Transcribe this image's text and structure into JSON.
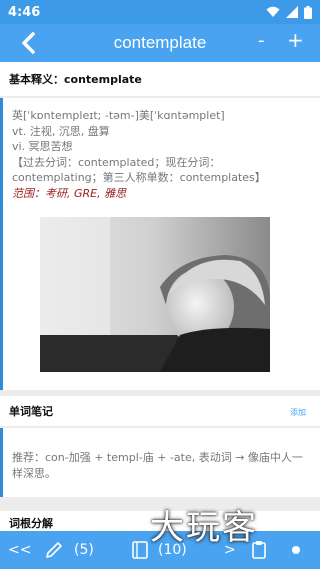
{
  "status": {
    "time": "4:46"
  },
  "appbar": {
    "title": "contemplate",
    "minus": "-",
    "plus": "+"
  },
  "basic": {
    "header": "基本释义：contemplate",
    "phonetic": "英[ˈkɒntempleɪt; -təm-]美[ˈkɑntəmplet]",
    "def1": "vt. 注视, 沉思, 盘算",
    "def2": "vi. 冥思苦想",
    "forms": "【过去分词：contemplated；现在分词：contemplating；第三人称单数：contemplates】",
    "scope": "范围：考研, GRE, 雅思"
  },
  "notes": {
    "header": "单词笔记",
    "link": "添加",
    "text": "推荐：con-加强 + templ-庙 + -ate, 表动词 → 像庙中人一样深思。"
  },
  "roots": {
    "header": "词根分解"
  },
  "bottom": {
    "prev": "<<",
    "note_count": "(5)",
    "book_count": "(10)",
    "next": ">"
  },
  "watermark": "大玩客"
}
